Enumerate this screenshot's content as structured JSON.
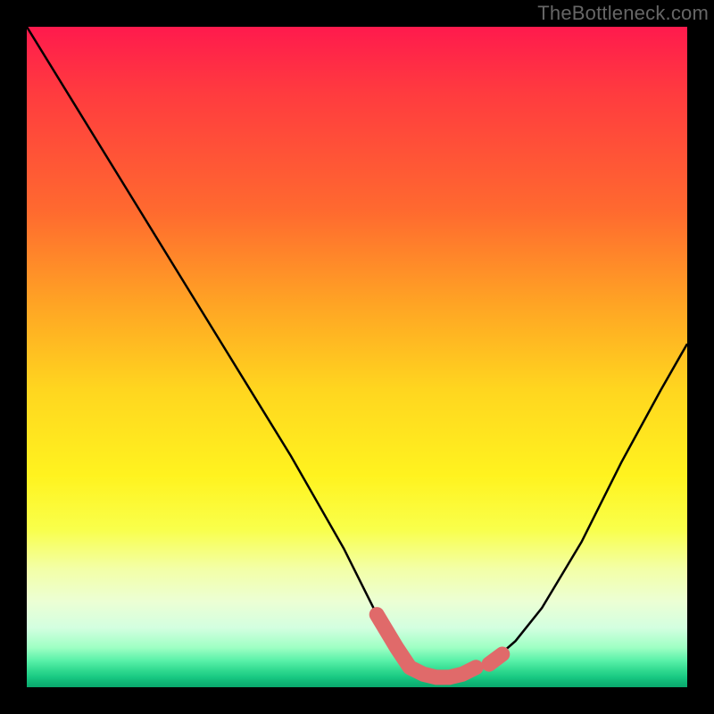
{
  "watermark": "TheBottleneck.com",
  "chart_data": {
    "type": "line",
    "title": "",
    "xlabel": "",
    "ylabel": "",
    "xlim": [
      0,
      100
    ],
    "ylim": [
      0,
      100
    ],
    "gradient_background": {
      "top_color": "#ff1a4d",
      "bottom_color": "#0aa86d",
      "description": "vertical rainbow gradient red→orange→yellow→green"
    },
    "series": [
      {
        "name": "bottleneck-curve",
        "x": [
          0,
          8,
          16,
          24,
          32,
          40,
          48,
          53,
          56,
          58,
          60,
          62,
          64,
          66,
          70,
          74,
          78,
          84,
          90,
          96,
          100
        ],
        "y": [
          100,
          87,
          74,
          61,
          48,
          35,
          21,
          11,
          6,
          3,
          2,
          1.5,
          1.5,
          2,
          3.5,
          7,
          12,
          22,
          34,
          45,
          52
        ],
        "stroke": "#000000",
        "stroke_width": 2
      },
      {
        "name": "highlight-band",
        "x": [
          53,
          56,
          58,
          60,
          62,
          64,
          66,
          68,
          70,
          72
        ],
        "y": [
          11,
          6,
          3,
          2,
          1.5,
          1.5,
          2,
          3,
          3.5,
          5
        ],
        "stroke": "#e06a6a",
        "stroke_width": 14
      }
    ]
  }
}
